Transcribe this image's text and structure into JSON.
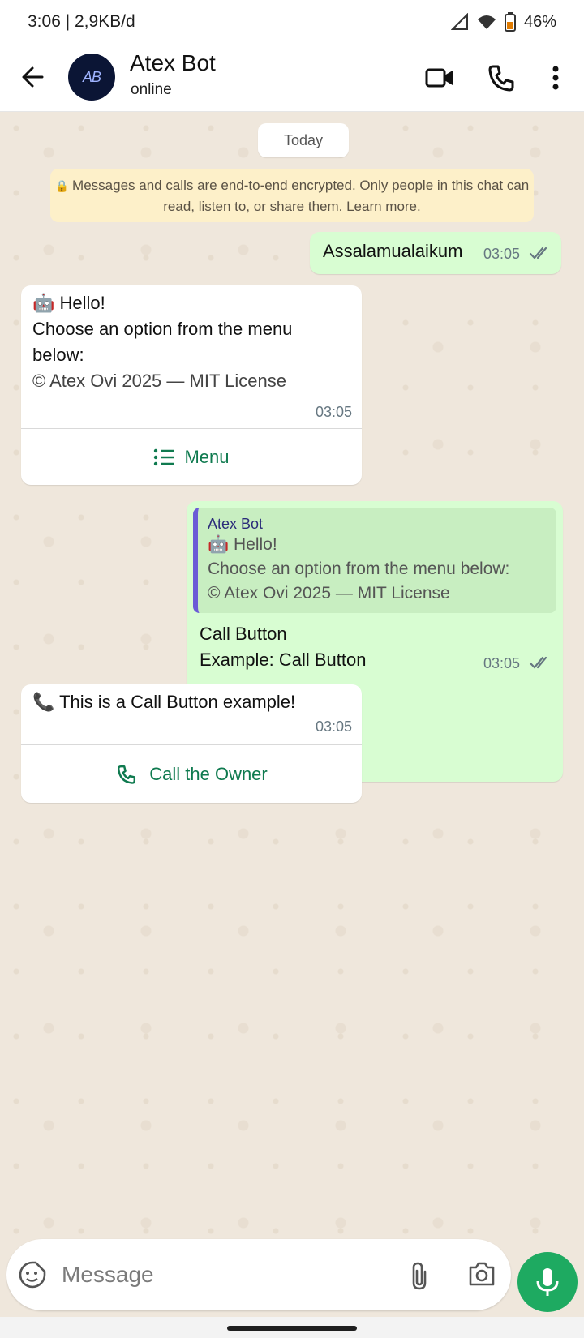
{
  "status": {
    "time_speed": "3:06 | 2,9KB/d",
    "battery": "46%"
  },
  "header": {
    "title": "Atex Bot",
    "subtitle": "online",
    "avatar_text": "AB"
  },
  "chat": {
    "date_label": "Today",
    "encryption_notice": "Messages and calls are end-to-end encrypted. Only people in this chat can read, listen to, or share them. Learn more.",
    "messages": [
      {
        "text": "Assalamualaikum",
        "time": "03:05"
      },
      {
        "line1": "🤖 Hello!",
        "line2": "Choose an option from the menu below:",
        "line3": "© Atex Ovi 2025 — MIT License",
        "time": "03:05",
        "button_label": "Menu"
      },
      {
        "quote_author": "Atex Bot",
        "quote_line1": "🤖 Hello!",
        "quote_line2": "Choose an option from the menu below:",
        "quote_line3": "© Atex Ovi 2025 — MIT License",
        "line1": "Call Button",
        "line2": "Example: Call Button",
        "time": "03:05"
      },
      {
        "text": "📞 This is a Call Button example!",
        "time": "03:05",
        "button_label": "Call the Owner"
      }
    ]
  },
  "composer": {
    "placeholder": "Message"
  },
  "colors": {
    "accent": "#1eaa61",
    "out_bubble": "#d8fdd2",
    "in_bubble": "#ffffff",
    "link_green": "#0f7a4f"
  }
}
